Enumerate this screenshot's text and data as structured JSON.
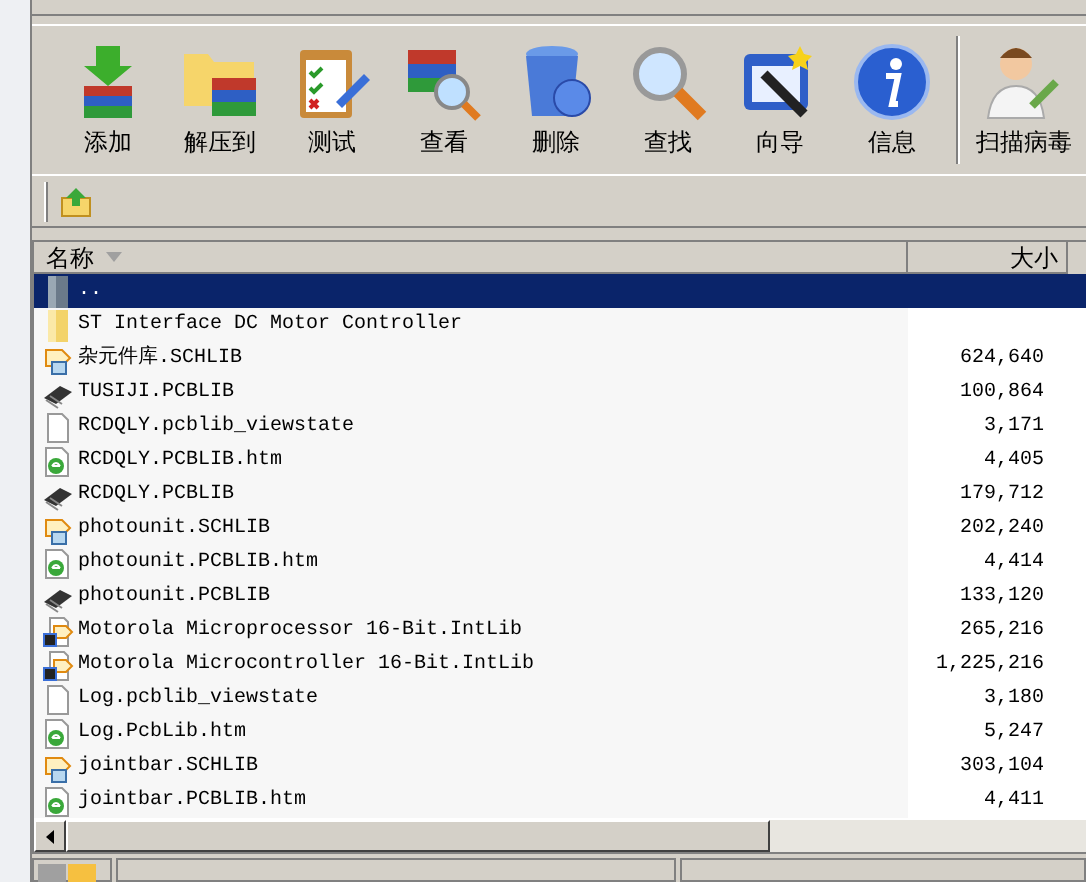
{
  "toolbar": [
    {
      "label": "添加",
      "kind": "add"
    },
    {
      "label": "解压到",
      "kind": "extract"
    },
    {
      "label": "测试",
      "kind": "test"
    },
    {
      "label": "查看",
      "kind": "view"
    },
    {
      "label": "删除",
      "kind": "delete"
    },
    {
      "label": "查找",
      "kind": "find"
    },
    {
      "label": "向导",
      "kind": "wizard"
    },
    {
      "label": "信息",
      "kind": "info"
    },
    {
      "label": "扫描病毒",
      "kind": "scan"
    }
  ],
  "columns": [
    {
      "label": "名称",
      "sorted": true
    },
    {
      "label": "大小",
      "sorted": false
    }
  ],
  "rows": [
    {
      "name": "..",
      "size": "",
      "kind": "up",
      "selected": true
    },
    {
      "name": "ST Interface DC Motor Controller",
      "size": "",
      "kind": "folder",
      "selected": false
    },
    {
      "name": "杂元件库.SCHLIB",
      "size": "624,640",
      "kind": "schlib",
      "selected": false
    },
    {
      "name": "TUSIJI.PCBLIB",
      "size": "100,864",
      "kind": "pcblib",
      "selected": false
    },
    {
      "name": "RCDQLY.pcblib_viewstate",
      "size": "3,171",
      "kind": "doc",
      "selected": false
    },
    {
      "name": "RCDQLY.PCBLIB.htm",
      "size": "4,405",
      "kind": "htm",
      "selected": false
    },
    {
      "name": "RCDQLY.PCBLIB",
      "size": "179,712",
      "kind": "pcblib",
      "selected": false
    },
    {
      "name": "photounit.SCHLIB",
      "size": "202,240",
      "kind": "schlib",
      "selected": false
    },
    {
      "name": "photounit.PCBLIB.htm",
      "size": "4,414",
      "kind": "htm",
      "selected": false
    },
    {
      "name": "photounit.PCBLIB",
      "size": "133,120",
      "kind": "pcblib",
      "selected": false
    },
    {
      "name": "Motorola Microprocessor 16-Bit.IntLib",
      "size": "265,216",
      "kind": "intlib",
      "selected": false
    },
    {
      "name": "Motorola Microcontroller 16-Bit.IntLib",
      "size": "1,225,216",
      "kind": "intlib",
      "selected": false
    },
    {
      "name": "Log.pcblib_viewstate",
      "size": "3,180",
      "kind": "doc",
      "selected": false
    },
    {
      "name": "Log.PcbLib.htm",
      "size": "5,247",
      "kind": "htm",
      "selected": false
    },
    {
      "name": "jointbar.SCHLIB",
      "size": "303,104",
      "kind": "schlib",
      "selected": false
    },
    {
      "name": "jointbar.PCBLIB.htm",
      "size": "4,411",
      "kind": "htm",
      "selected": false
    }
  ]
}
